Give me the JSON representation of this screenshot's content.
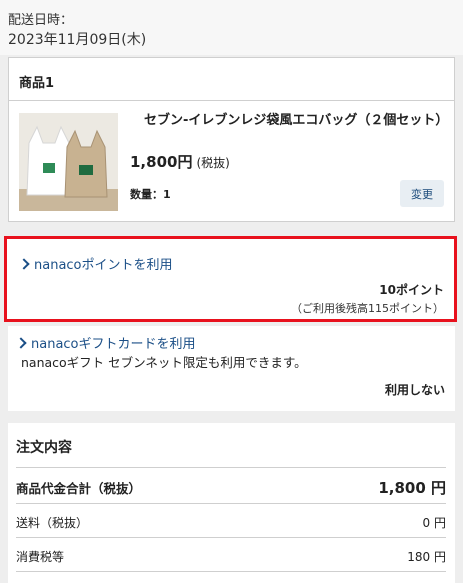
{
  "delivery": {
    "label": "配送日時：",
    "date": "2023年11月09日(木)"
  },
  "product": {
    "section_title": "商品1",
    "name": "セブン‐イレブンレジ袋風エコバッグ（２個セット）",
    "price": "1,800円",
    "tax_note": "(税抜)",
    "quantity": "数量：1",
    "change_label": "変更"
  },
  "nanaco_point": {
    "link_label": "nanacoポイントを利用",
    "points": "10ポイント",
    "remaining": "（ご利用後残高115ポイント）"
  },
  "nanaco_gift": {
    "link_label": "nanacoギフトカードを利用",
    "description": "nanacoギフト セブンネット限定も利用できます。",
    "status": "利用しない"
  },
  "order_summary": {
    "title": "注文内容",
    "rows": [
      {
        "label": "商品代金合計（税抜）",
        "value": "1,800 円"
      },
      {
        "label": "送料（税抜）",
        "value": "0 円"
      },
      {
        "label": "消費税等",
        "value": "180 円"
      }
    ]
  },
  "colors": {
    "highlight_border": "#e8111d",
    "link": "#1b4f87",
    "button_bg": "#e8eef3"
  }
}
